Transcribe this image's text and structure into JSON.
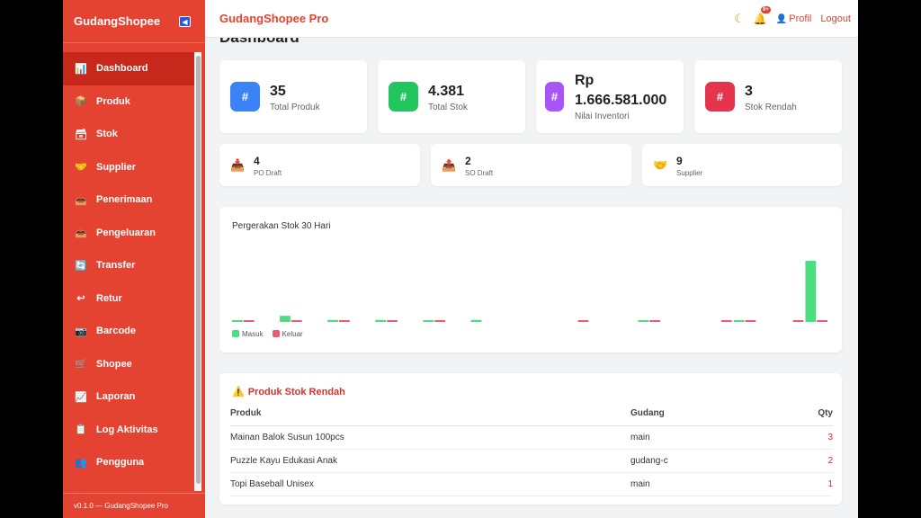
{
  "sidebar": {
    "brand": "GudangShopee",
    "collapse_icon": "◀",
    "items": [
      {
        "label": "Dashboard",
        "icon": "📊"
      },
      {
        "label": "Produk",
        "icon": "📦"
      },
      {
        "label": "Stok",
        "icon": "🗃"
      },
      {
        "label": "Supplier",
        "icon": "🤝"
      },
      {
        "label": "Penerimaan",
        "icon": "📥"
      },
      {
        "label": "Pengeluaran",
        "icon": "📤"
      },
      {
        "label": "Transfer",
        "icon": "🔄"
      },
      {
        "label": "Retur",
        "icon": "↩"
      },
      {
        "label": "Barcode",
        "icon": "📷"
      },
      {
        "label": "Shopee",
        "icon": "🛒"
      },
      {
        "label": "Laporan",
        "icon": "📈"
      },
      {
        "label": "Log Aktivitas",
        "icon": "📋"
      },
      {
        "label": "Pengguna",
        "icon": "👥"
      }
    ],
    "version": "v0.1.0 — GudangShopee Pro"
  },
  "topbar": {
    "title": "GudangShopee Pro",
    "notification_count": "9+",
    "profile": "Profil",
    "logout": "Logout"
  },
  "page_title": "Dashboard",
  "stats": [
    {
      "value": "35",
      "label": "Total Produk",
      "color": "#3b82f6",
      "icon": "#"
    },
    {
      "value": "4.381",
      "label": "Total Stok",
      "color": "#22c55e",
      "icon": "#"
    },
    {
      "value_line1": "Rp",
      "value_line2": "1.666.581.000",
      "label": "Nilai Inventori",
      "color": "#a855f7",
      "icon": "#"
    },
    {
      "value": "3",
      "label": "Stok Rendah",
      "color": "#e5354d",
      "icon": "#"
    }
  ],
  "mini_stats": [
    {
      "value": "4",
      "label": "PO Draft",
      "icon": "📥"
    },
    {
      "value": "2",
      "label": "SO Draft",
      "icon": "📤"
    },
    {
      "value": "9",
      "label": "Supplier",
      "icon": "🤝"
    }
  ],
  "chart_data": {
    "type": "bar",
    "title": "Pergerakan Stok 30 Hari",
    "series": [
      {
        "name": "Masuk",
        "color": "#4ade80",
        "values": [
          1,
          0,
          6,
          0,
          2,
          0,
          2,
          0,
          1,
          0,
          2,
          0,
          0,
          0,
          0,
          0,
          0,
          1,
          0,
          0,
          0,
          1,
          0,
          0,
          60
        ]
      },
      {
        "name": "Keluar",
        "color": "#ef5a6f",
        "values": [
          1,
          0,
          1,
          0,
          1,
          0,
          1,
          0,
          1,
          0,
          0,
          0,
          0,
          0,
          1,
          0,
          0,
          1,
          0,
          0,
          1,
          1,
          0,
          1,
          1
        ]
      }
    ]
  },
  "low_stock": {
    "title": "Produk Stok Rendah",
    "headers": {
      "produk": "Produk",
      "gudang": "Gudang",
      "qty": "Qty"
    },
    "rows": [
      {
        "produk": "Mainan Balok Susun 100pcs",
        "gudang": "main",
        "qty": "3"
      },
      {
        "produk": "Puzzle Kayu Edukasi Anak",
        "gudang": "gudang-c",
        "qty": "2"
      },
      {
        "produk": "Topi Baseball Unisex",
        "gudang": "main",
        "qty": "1"
      }
    ]
  }
}
